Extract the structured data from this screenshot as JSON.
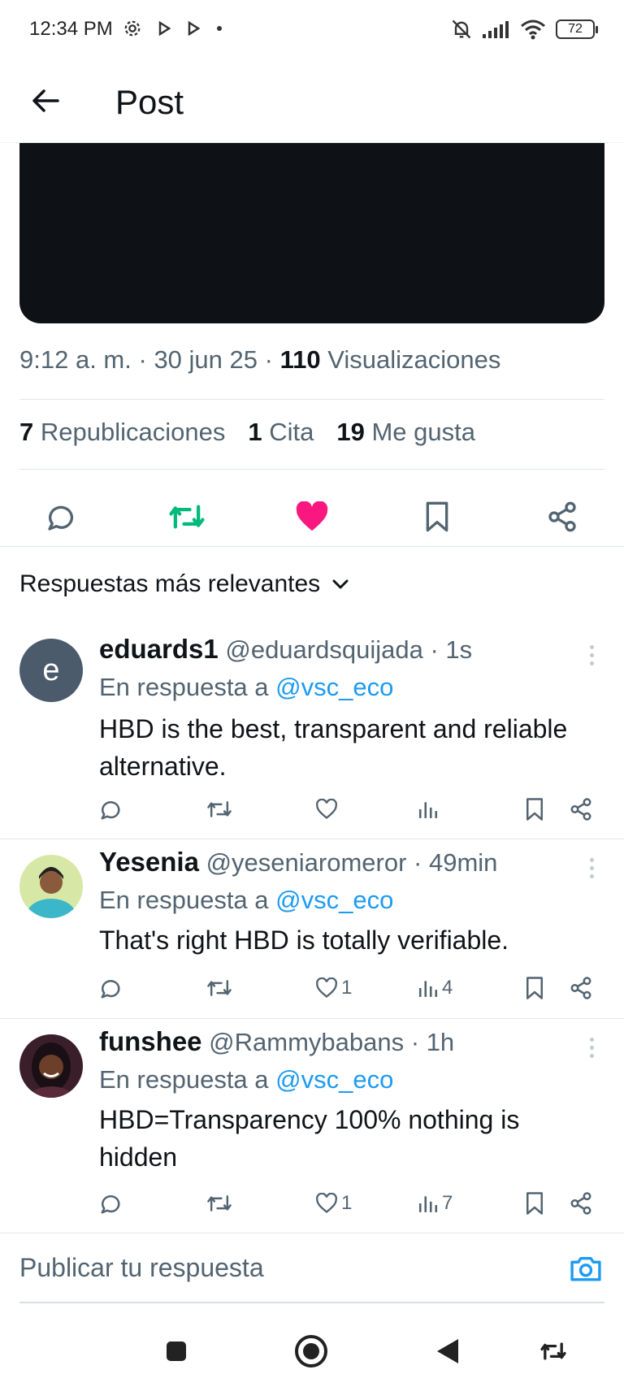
{
  "status_bar": {
    "time": "12:34 PM",
    "battery": "72",
    "icons": [
      "gear-icon",
      "play-icon",
      "play-icon",
      "dot-icon",
      "muted-bell-icon",
      "signal-icon",
      "wifi-icon",
      "battery-icon"
    ]
  },
  "header": {
    "title": "Post",
    "back_icon": "arrow-left-icon"
  },
  "post": {
    "time": "9:12 a. m.",
    "separator": "·",
    "date": "30 jun 25",
    "views_count": "110",
    "views_label": "Visualizaciones",
    "reposts_count": "7",
    "reposts_label": "Republicaciones",
    "quotes_count": "1",
    "quotes_label": "Cita",
    "likes_count": "19",
    "likes_label": "Me gusta",
    "actions": {
      "reply_icon": "comment-icon",
      "repost_icon": "repost-icon",
      "like_icon": "heart-filled-icon",
      "bookmark_icon": "bookmark-icon",
      "share_icon": "share-icon"
    },
    "colors": {
      "repost_active": "#00ba7c",
      "like_active": "#f91880",
      "link": "#1d9bf0",
      "secondary_text": "#536471"
    }
  },
  "replies_header": {
    "label": "Respuestas más relevantes",
    "icon": "chevron-down-icon"
  },
  "replies": [
    {
      "avatar_letter": "e",
      "name": "eduards1",
      "handle": "@eduardsquijada",
      "time": "1s",
      "in_reply_prefix": "En respuesta a",
      "in_reply_to": "@vsc_eco",
      "text": "HBD is the best, transparent and reliable alternative.",
      "likes": "",
      "views": ""
    },
    {
      "avatar_letter": "",
      "name": "Yesenia",
      "handle": "@yeseniaromeror",
      "time": "49min",
      "in_reply_prefix": "En respuesta a",
      "in_reply_to": "@vsc_eco",
      "text": "That's right HBD is totally verifiable.",
      "likes": "1",
      "views": "4"
    },
    {
      "avatar_letter": "",
      "name": "funshee",
      "handle": "@Rammybabans",
      "time": "1h",
      "in_reply_prefix": "En respuesta a",
      "in_reply_to": "@vsc_eco",
      "text": "HBD=Transparency 100% nothing is hidden",
      "likes": "1",
      "views": "7"
    }
  ],
  "compose": {
    "placeholder": "Publicar tu respuesta",
    "camera_icon": "camera-icon"
  },
  "nav_bar": {
    "icons": [
      "square-icon",
      "home-circle-icon",
      "back-triangle-icon",
      "rotate-icon"
    ]
  }
}
